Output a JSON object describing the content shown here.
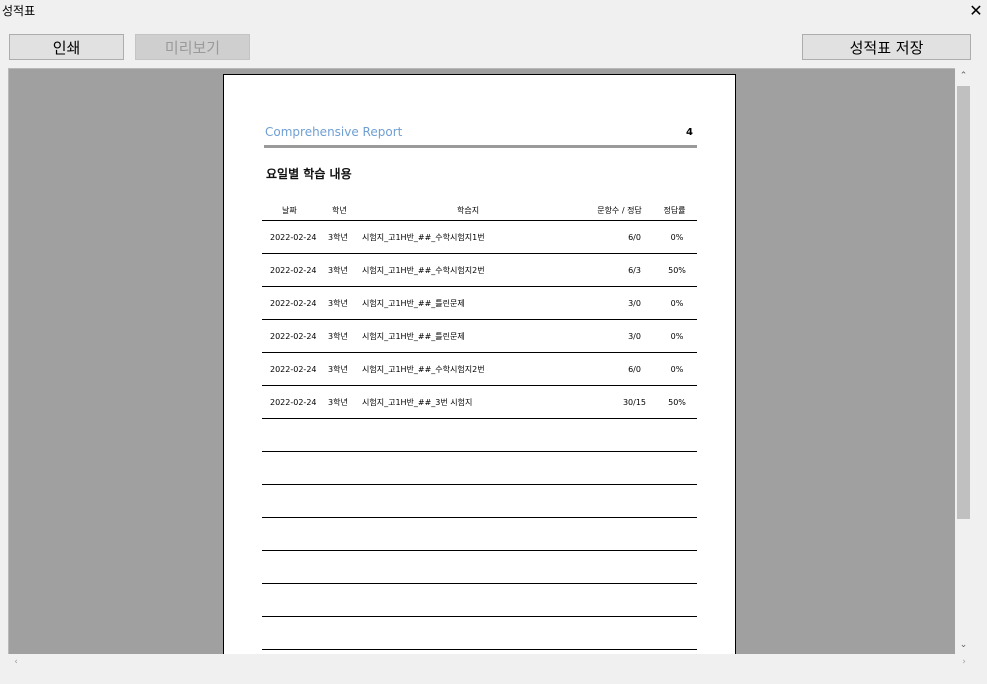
{
  "window": {
    "title": "성적표",
    "close_glyph": "✕"
  },
  "toolbar": {
    "print_label": "인쇄",
    "preview_label": "미리보기",
    "save_label": "성적표 저장"
  },
  "report": {
    "title": "Comprehensive  Report",
    "page_number": "4",
    "section_title": "요일별 학습 내용",
    "columns": {
      "date": "날짜",
      "grade": "학년",
      "sheet": "학습지",
      "count": "문항수 / 정답",
      "rate": "정답률"
    },
    "rows": [
      {
        "date": "2022-02-24",
        "grade": "3학년",
        "sheet": "시험지_고1H반_##_수학시험지1번",
        "count": "6/0",
        "rate": "0%"
      },
      {
        "date": "2022-02-24",
        "grade": "3학년",
        "sheet": "시험지_고1H반_##_수학시험지2번",
        "count": "6/3",
        "rate": "50%"
      },
      {
        "date": "2022-02-24",
        "grade": "3학년",
        "sheet": "시험지_고1H반_##_틀린문제",
        "count": "3/0",
        "rate": "0%"
      },
      {
        "date": "2022-02-24",
        "grade": "3학년",
        "sheet": "시험지_고1H반_##_틀린문제",
        "count": "3/0",
        "rate": "0%"
      },
      {
        "date": "2022-02-24",
        "grade": "3학년",
        "sheet": "시험지_고1H반_##_수학시험지2번",
        "count": "6/0",
        "rate": "0%"
      },
      {
        "date": "2022-02-24",
        "grade": "3학년",
        "sheet": "시험지_고1H반_##_3번 시험지",
        "count": "30/15",
        "rate": "50%"
      }
    ],
    "empty_rows": 7
  },
  "colors": {
    "accent": "#6f9fd2",
    "preview_bg": "#a0a0a0",
    "button_bg": "#e1e1e1"
  },
  "icons": {
    "close": "close-icon",
    "scroll_up": "chevron-up-icon",
    "scroll_down": "chevron-down-icon",
    "scroll_left": "chevron-left-icon",
    "scroll_right": "chevron-right-icon"
  }
}
